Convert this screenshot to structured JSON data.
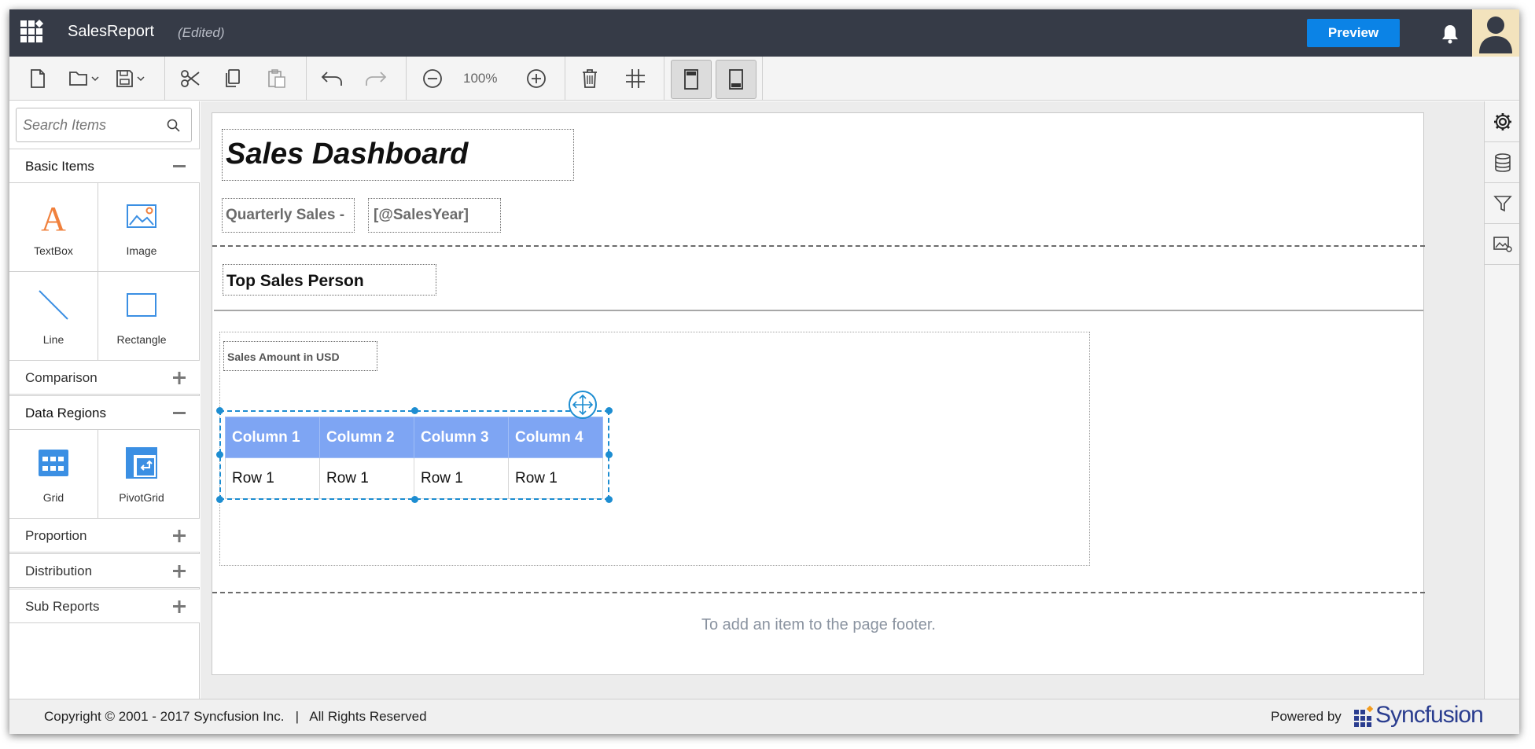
{
  "header": {
    "app_title": "SalesReport",
    "edited": "(Edited)",
    "preview_label": "Preview"
  },
  "toolbar": {
    "zoom": "100%"
  },
  "left_panel": {
    "search_placeholder": "Search Items",
    "sections": {
      "basic_items": "Basic Items",
      "comparison": "Comparison",
      "data_regions": "Data Regions",
      "proportion": "Proportion",
      "distribution": "Distribution",
      "sub_reports": "Sub Reports"
    },
    "items": {
      "textbox": "TextBox",
      "image": "Image",
      "line": "Line",
      "rectangle": "Rectangle",
      "grid": "Grid",
      "pivotgrid": "PivotGrid"
    }
  },
  "report": {
    "title": "Sales Dashboard",
    "quarterly_label": "Quarterly Sales -",
    "sales_year_param": "[@SalesYear]",
    "top_sales_person": "Top Sales Person",
    "chart_title": "Sales Amount in USD",
    "grid_columns": [
      "Column 1",
      "Column 2",
      "Column 3",
      "Column 4"
    ],
    "grid_rows": [
      [
        "Row 1",
        "Row 1",
        "Row 1",
        "Row 1"
      ]
    ],
    "footer_hint": "To add an item to the page footer."
  },
  "statusbar": {
    "copyright": "Copyright © 2001 - 2017 Syncfusion Inc.   |   All Rights Reserved",
    "powered_by": "Powered by",
    "brand": "Syncfusion"
  },
  "colors": {
    "header_bg": "#363b47",
    "preview_btn": "#0b83e6",
    "grid_header": "#7ea5f3",
    "selection": "#1d8dd1",
    "icon_orange": "#f0803c",
    "icon_blue": "#3b8fe3"
  }
}
